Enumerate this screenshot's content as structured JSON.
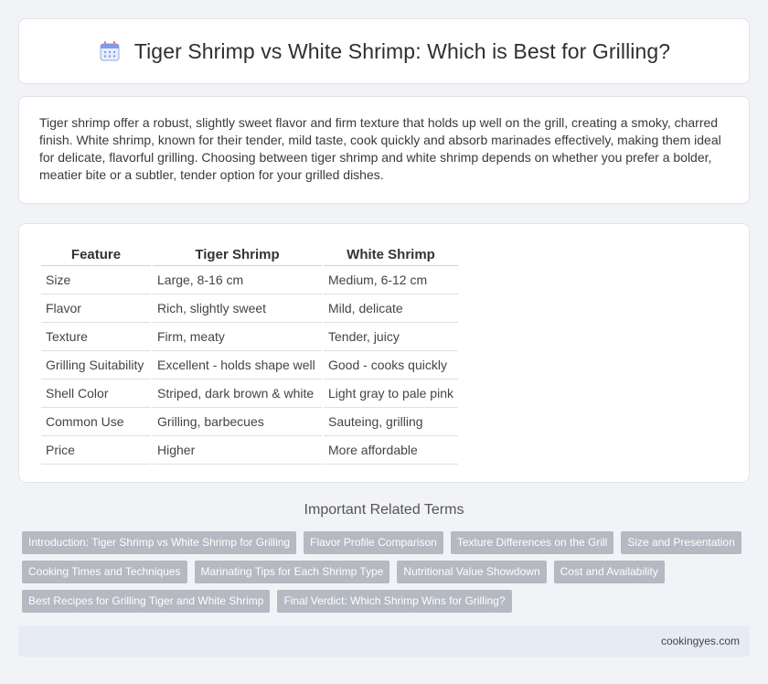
{
  "header": {
    "title": "Tiger Shrimp vs White Shrimp: Which is Best for Grilling?",
    "icon": "calendar-icon"
  },
  "intro": {
    "text": "Tiger shrimp offer a robust, slightly sweet flavor and firm texture that holds up well on the grill, creating a smoky, charred finish. White shrimp, known for their tender, mild taste, cook quickly and absorb marinades effectively, making them ideal for delicate, flavorful grilling. Choosing between tiger shrimp and white shrimp depends on whether you prefer a bolder, meatier bite or a subtler, tender option for your grilled dishes."
  },
  "table": {
    "headers": [
      "Feature",
      "Tiger Shrimp",
      "White Shrimp"
    ],
    "rows": [
      [
        "Size",
        "Large, 8-16 cm",
        "Medium, 6-12 cm"
      ],
      [
        "Flavor",
        "Rich, slightly sweet",
        "Mild, delicate"
      ],
      [
        "Texture",
        "Firm, meaty",
        "Tender, juicy"
      ],
      [
        "Grilling Suitability",
        "Excellent - holds shape well",
        "Good - cooks quickly"
      ],
      [
        "Shell Color",
        "Striped, dark brown & white",
        "Light gray to pale pink"
      ],
      [
        "Common Use",
        "Grilling, barbecues",
        "Sauteing, grilling"
      ],
      [
        "Price",
        "Higher",
        "More affordable"
      ]
    ]
  },
  "related": {
    "title": "Important Related Terms",
    "tags": [
      "Introduction: Tiger Shrimp vs White Shrimp for Grilling",
      "Flavor Profile Comparison",
      "Texture Differences on the Grill",
      "Size and Presentation",
      "Cooking Times and Techniques",
      "Marinating Tips for Each Shrimp Type",
      "Nutritional Value Showdown",
      "Cost and Availability",
      "Best Recipes for Grilling Tiger and White Shrimp",
      "Final Verdict: Which Shrimp Wins for Grilling?"
    ]
  },
  "footer": {
    "site": "cookingyes.com"
  },
  "colors": {
    "page_bg": "#f2f3f7",
    "tag_bg": "#b5b9c1",
    "footer_bg": "#e7ebf5",
    "icon_blue": "#5b8def"
  }
}
